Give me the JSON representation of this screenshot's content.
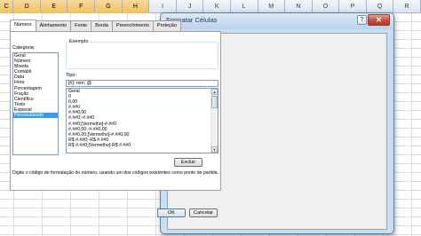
{
  "spreadsheet": {
    "columns": [
      "C",
      "D",
      "E",
      "F",
      "G",
      "H",
      "I",
      "J",
      "K",
      "L",
      "M",
      "N",
      "O",
      "P",
      "Q",
      "R"
    ],
    "selected_columns": [
      "C",
      "D",
      "E",
      "F",
      "G",
      "H"
    ]
  },
  "dialog": {
    "title": "Formatar Células",
    "help_label": "?",
    "close_label": "✕",
    "tabs": [
      "Número",
      "Alinhamento",
      "Fonte",
      "Borda",
      "Preenchimento",
      "Proteção"
    ],
    "active_tab": "Número",
    "category_label": "Categoria:",
    "categories": [
      "Geral",
      "Número",
      "Moeda",
      "Contábil",
      "Data",
      "Hora",
      "Porcentagem",
      "Fração",
      "Científico",
      "Texto",
      "Especial",
      "Personalizado"
    ],
    "selected_category": "Personalizado",
    "sample_label": "Exemplo",
    "type_label": "Tipo:",
    "type_value": "[h]: mm; @",
    "format_codes": [
      "Geral",
      "0",
      "0,00",
      "#.##0",
      "#.##0,00",
      "#.##0;-#.##0",
      "#.##0;[Vermelho]-#.##0",
      "#.##0,00;-#.##0,00",
      "#.##0,00;[Vermelho]-#.##0,00",
      "R$ #.##0;-R$ #.##0",
      "R$ #.##0;[Vermelho]-R$ #.##0"
    ],
    "delete_label": "Excluir",
    "hint": "Digite o código de formatação do número, usando um dos códigos existentes como ponto de partida.",
    "ok_label": "OK",
    "cancel_label": "Cancelar"
  }
}
